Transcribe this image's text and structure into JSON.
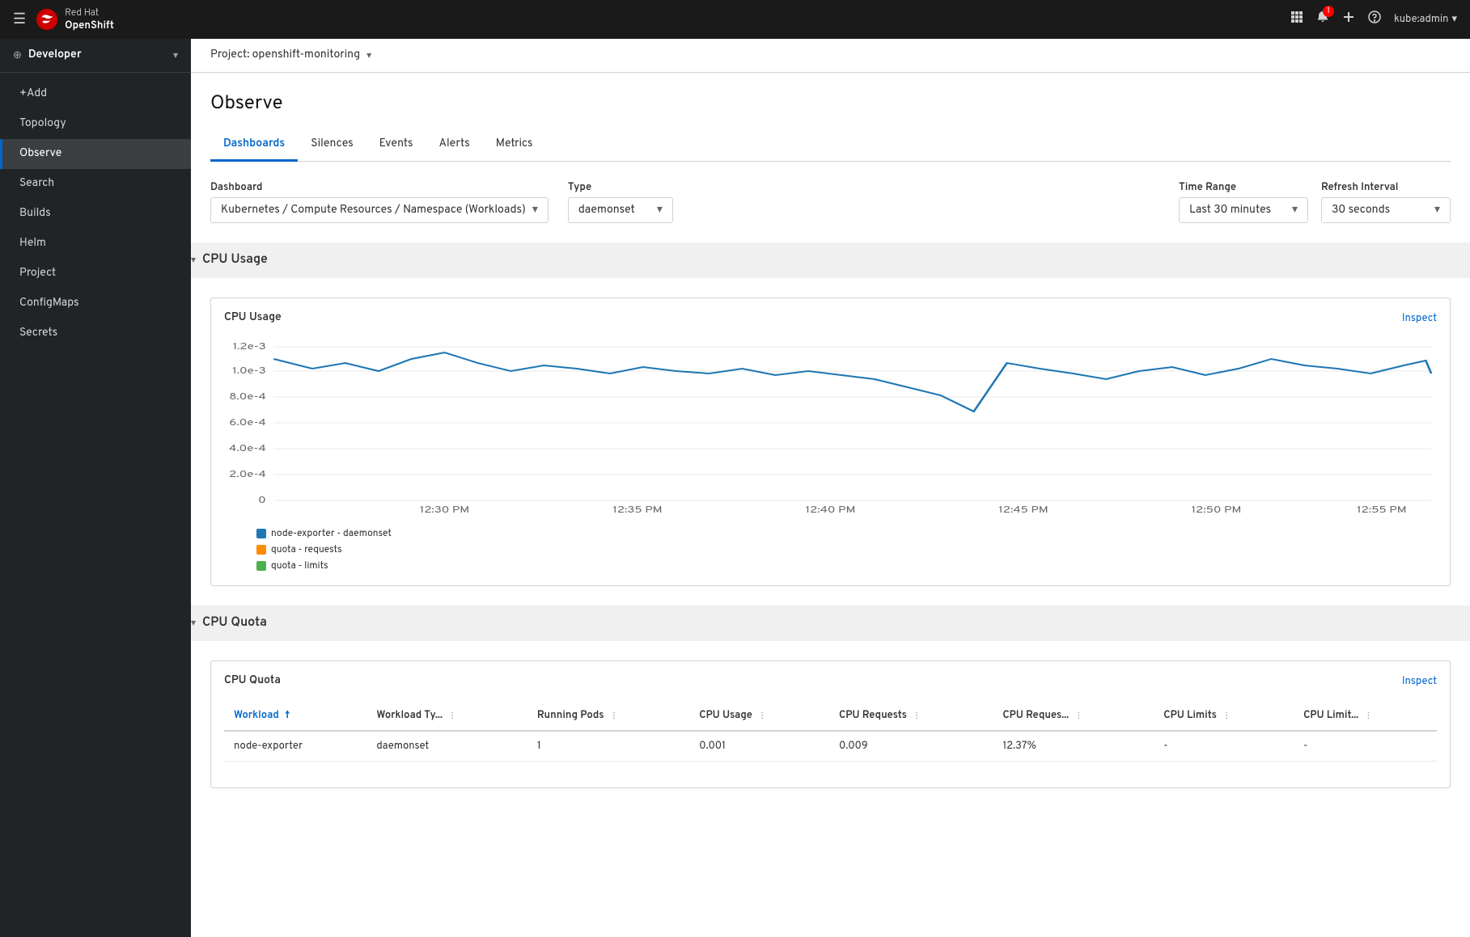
{
  "topnav": {
    "brand": "Red Hat",
    "product": "OpenShift",
    "notifications_count": "1",
    "user": "kube:admin",
    "user_chevron": "▾"
  },
  "sidebar": {
    "context": "Developer",
    "items": [
      {
        "id": "add",
        "label": "+Add",
        "active": false
      },
      {
        "id": "topology",
        "label": "Topology",
        "active": false
      },
      {
        "id": "observe",
        "label": "Observe",
        "active": true
      },
      {
        "id": "search",
        "label": "Search",
        "active": false
      },
      {
        "id": "builds",
        "label": "Builds",
        "active": false
      },
      {
        "id": "helm",
        "label": "Helm",
        "active": false
      },
      {
        "id": "project",
        "label": "Project",
        "active": false
      },
      {
        "id": "configmaps",
        "label": "ConfigMaps",
        "active": false
      },
      {
        "id": "secrets",
        "label": "Secrets",
        "active": false
      }
    ]
  },
  "project_bar": {
    "label": "Project: openshift-monitoring"
  },
  "page": {
    "title": "Observe"
  },
  "tabs": [
    {
      "id": "dashboards",
      "label": "Dashboards",
      "active": true
    },
    {
      "id": "silences",
      "label": "Silences",
      "active": false
    },
    {
      "id": "events",
      "label": "Events",
      "active": false
    },
    {
      "id": "alerts",
      "label": "Alerts",
      "active": false
    },
    {
      "id": "metrics",
      "label": "Metrics",
      "active": false
    }
  ],
  "controls": {
    "dashboard_label": "Dashboard",
    "dashboard_value": "Kubernetes / Compute Resources / Namespace (Workloads)",
    "type_label": "Type",
    "type_value": "daemonset",
    "time_range_label": "Time Range",
    "time_range_value": "Last 30 minutes",
    "refresh_interval_label": "Refresh Interval",
    "refresh_interval_value": "30 seconds"
  },
  "cpu_usage_section": {
    "title": "CPU Usage",
    "chart_title": "CPU Usage",
    "inspect_label": "Inspect",
    "y_labels": [
      "1.2e-3",
      "1.0e-3",
      "8.0e-4",
      "6.0e-4",
      "4.0e-4",
      "2.0e-4",
      "0"
    ],
    "x_labels": [
      "12:30 PM",
      "12:35 PM",
      "12:40 PM",
      "12:45 PM",
      "12:50 PM",
      "12:55 PM"
    ],
    "legend": [
      {
        "label": "node-exporter - daemonset",
        "color": "#1f77b4"
      },
      {
        "label": "quota - requests",
        "color": "#ff8c00"
      },
      {
        "label": "quota - limits",
        "color": "#4caf50"
      }
    ]
  },
  "cpu_quota_section": {
    "title": "CPU Quota",
    "chart_title": "CPU Quota",
    "inspect_label": "Inspect",
    "table": {
      "columns": [
        {
          "id": "workload",
          "label": "Workload",
          "sorted": true
        },
        {
          "id": "workload_type",
          "label": "Workload Ty..."
        },
        {
          "id": "running_pods",
          "label": "Running Pods"
        },
        {
          "id": "cpu_usage",
          "label": "CPU Usage"
        },
        {
          "id": "cpu_requests",
          "label": "CPU Requests"
        },
        {
          "id": "cpu_requests_pct",
          "label": "CPU Reques..."
        },
        {
          "id": "cpu_limits",
          "label": "CPU Limits"
        },
        {
          "id": "cpu_limit_pct",
          "label": "CPU Limit..."
        }
      ],
      "rows": [
        {
          "workload": "node-exporter",
          "workload_type": "daemonset",
          "running_pods": "1",
          "cpu_usage": "0.001",
          "cpu_requests": "0.009",
          "cpu_requests_pct": "12.37%",
          "cpu_limits": "-",
          "cpu_limit_pct": "-"
        }
      ]
    }
  }
}
